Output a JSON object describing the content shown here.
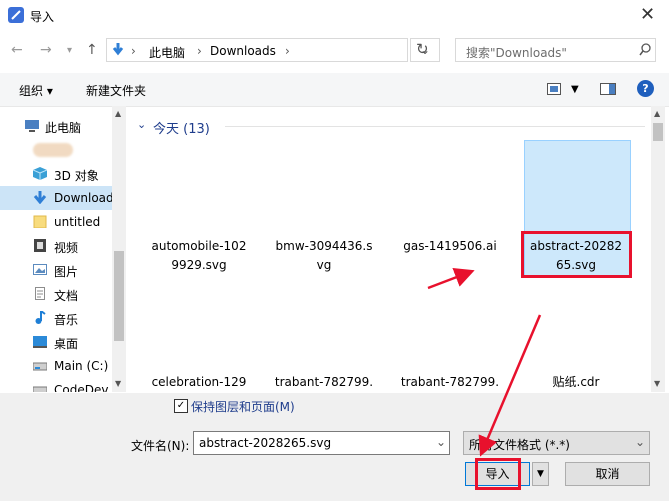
{
  "window": {
    "title": "导入",
    "close": "✕"
  },
  "address": {
    "crumbs": [
      "此电脑",
      "Downloads"
    ],
    "search_placeholder": "搜索\"Downloads\""
  },
  "toolbar": {
    "organize": "组织 ▾",
    "new_folder": "新建文件夹"
  },
  "sidebar": {
    "items": [
      {
        "label": "此电脑",
        "icon": "computer-icon",
        "color": "#4a7fc1"
      },
      {
        "label": "",
        "icon": "user-icon",
        "color": "#e9b27b"
      },
      {
        "label": "3D 对象",
        "icon": "cube-icon",
        "color": "#3aa0d6"
      },
      {
        "label": "Downloads",
        "icon": "download-arrow-icon",
        "color": "#2f7fd6"
      },
      {
        "label": "untitled",
        "icon": "folder-icon",
        "color": "#f5d76e"
      },
      {
        "label": "视频",
        "icon": "film-icon",
        "color": "#555555"
      },
      {
        "label": "图片",
        "icon": "picture-icon",
        "color": "#5b8bbf"
      },
      {
        "label": "文档",
        "icon": "document-icon",
        "color": "#8d8d8d"
      },
      {
        "label": "音乐",
        "icon": "music-note-icon",
        "color": "#1e7fd6"
      },
      {
        "label": "桌面",
        "icon": "desktop-icon",
        "color": "#2b8ad8"
      },
      {
        "label": "Main (C:)",
        "icon": "drive-icon",
        "color": "#7a7a7a"
      },
      {
        "label": "CodeDev",
        "icon": "drive-icon",
        "color": "#7a7a7a"
      }
    ]
  },
  "content": {
    "group_title": "今天 (13)",
    "row1": [
      {
        "line1": "automobile-102",
        "line2": "9929.svg"
      },
      {
        "line1": "bmw-3094436.s",
        "line2": "vg"
      },
      {
        "line1": "gas-1419506.ai",
        "line2": ""
      },
      {
        "line1": "abstract-20282",
        "line2": "65.svg"
      }
    ],
    "row2": [
      "celebration-129",
      "trabant-782799.",
      "trabant-782799.",
      "贴纸.cdr"
    ]
  },
  "bottom": {
    "checkbox_label": "保持图层和页面(M)",
    "checkbox_mark": "✓",
    "filename_label": "文件名(N):",
    "filename_value": "abstract-2028265.svg",
    "filetype_value": "所有文件格式 (*.*)",
    "import_button": "导入",
    "cancel_button": "取消"
  },
  "colors": {
    "accent": "#1f3d8c",
    "annotation_red": "#e8112d",
    "selection": "#cde8fb"
  }
}
